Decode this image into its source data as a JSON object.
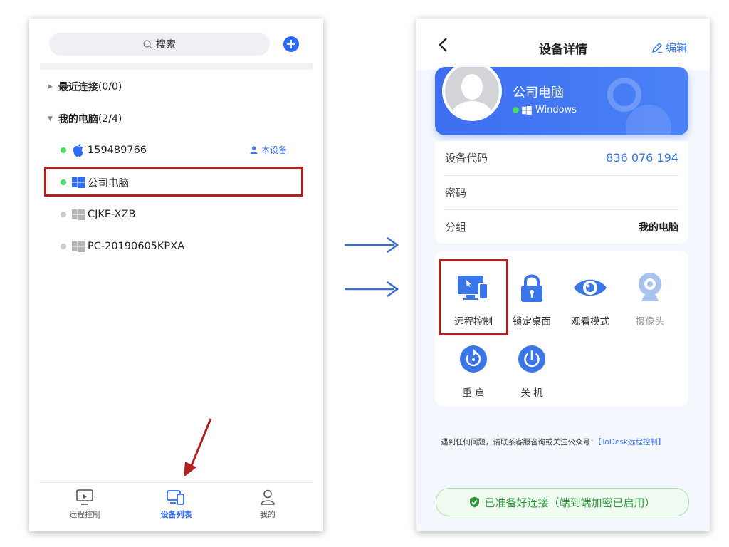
{
  "left_phone": {
    "search_placeholder": "搜索",
    "groups": [
      {
        "name": "最近连接",
        "count": "(0/0)"
      },
      {
        "name": "我的电脑",
        "count": "(2/4)"
      }
    ],
    "devices": [
      {
        "name": "159489766",
        "os": "apple-icon",
        "online": true,
        "tag": "本设备"
      },
      {
        "name": "公司电脑",
        "os": "windows-icon",
        "online": true
      },
      {
        "name": "CJKE-XZB",
        "os": "windows-icon",
        "online": false
      },
      {
        "name": "PC-20190605KPXA",
        "os": "windows-icon",
        "online": false
      }
    ],
    "tabs": [
      {
        "label": "远程控制",
        "icon": "remote-monitor-icon",
        "active": false
      },
      {
        "label": "设备列表",
        "icon": "device-list-icon",
        "active": true
      },
      {
        "label": "我的",
        "icon": "person-icon",
        "active": false
      }
    ]
  },
  "right_phone": {
    "title": "设备详情",
    "edit_label": "编辑",
    "profile": {
      "name": "公司电脑",
      "os": "Windows"
    },
    "info_rows": [
      {
        "label": "设备代码",
        "value": "836 076 194"
      },
      {
        "label": "密码",
        "value": ""
      },
      {
        "label": "分组",
        "value": "我的电脑"
      }
    ],
    "actions": [
      {
        "label": "远程控制",
        "icon": "remote-control-icon"
      },
      {
        "label": "锁定桌面",
        "icon": "lock-icon"
      },
      {
        "label": "观看模式",
        "icon": "eye-icon"
      },
      {
        "label": "摄像头",
        "icon": "camera-icon",
        "disabled": true
      },
      {
        "label": "重 启",
        "icon": "restart-icon"
      },
      {
        "label": "关 机",
        "icon": "power-icon"
      }
    ],
    "note_text": "遇到任何问题，请联系客服咨询或关注公众号：",
    "note_link": "【ToDesk远程控制】",
    "ready_text": "已准备好连接（端到端加密已启用）"
  },
  "colors": {
    "accent": "#2d6cf6",
    "online": "#4cd964",
    "offline": "#cccccc",
    "highlight": "#b11f1f",
    "ready_green": "#2f9a3c"
  }
}
